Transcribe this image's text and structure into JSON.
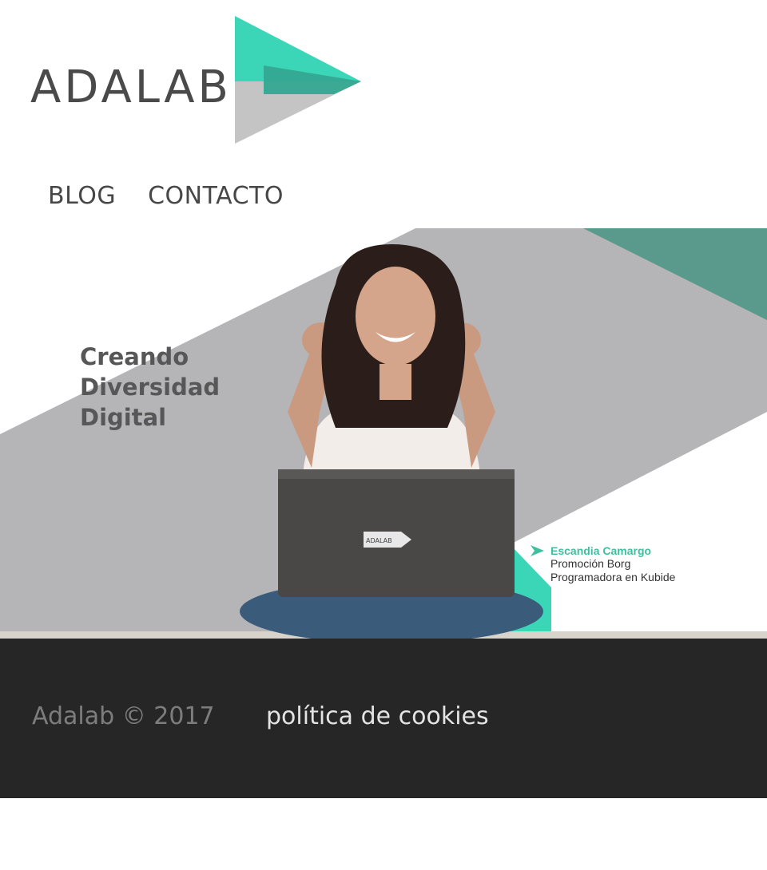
{
  "brand": {
    "logo_text": "ADALAB",
    "accent_color": "#3bd6b8",
    "dark_teal": "#5a9a8c",
    "gray": "#b5b5b8"
  },
  "nav": {
    "items": [
      {
        "label": "BLOG"
      },
      {
        "label": "CONTACTO"
      }
    ]
  },
  "hero": {
    "tagline": [
      "Creando",
      "Diversidad",
      "Digital"
    ],
    "laptop_logo_text": "ADALAB",
    "caption": {
      "name": "Escandia Camargo",
      "line1": "Promoción Borg",
      "line2": "Programadora en Kubide"
    }
  },
  "footer": {
    "copyright": "Adalab © 2017",
    "cookies_link": "política de cookies"
  }
}
